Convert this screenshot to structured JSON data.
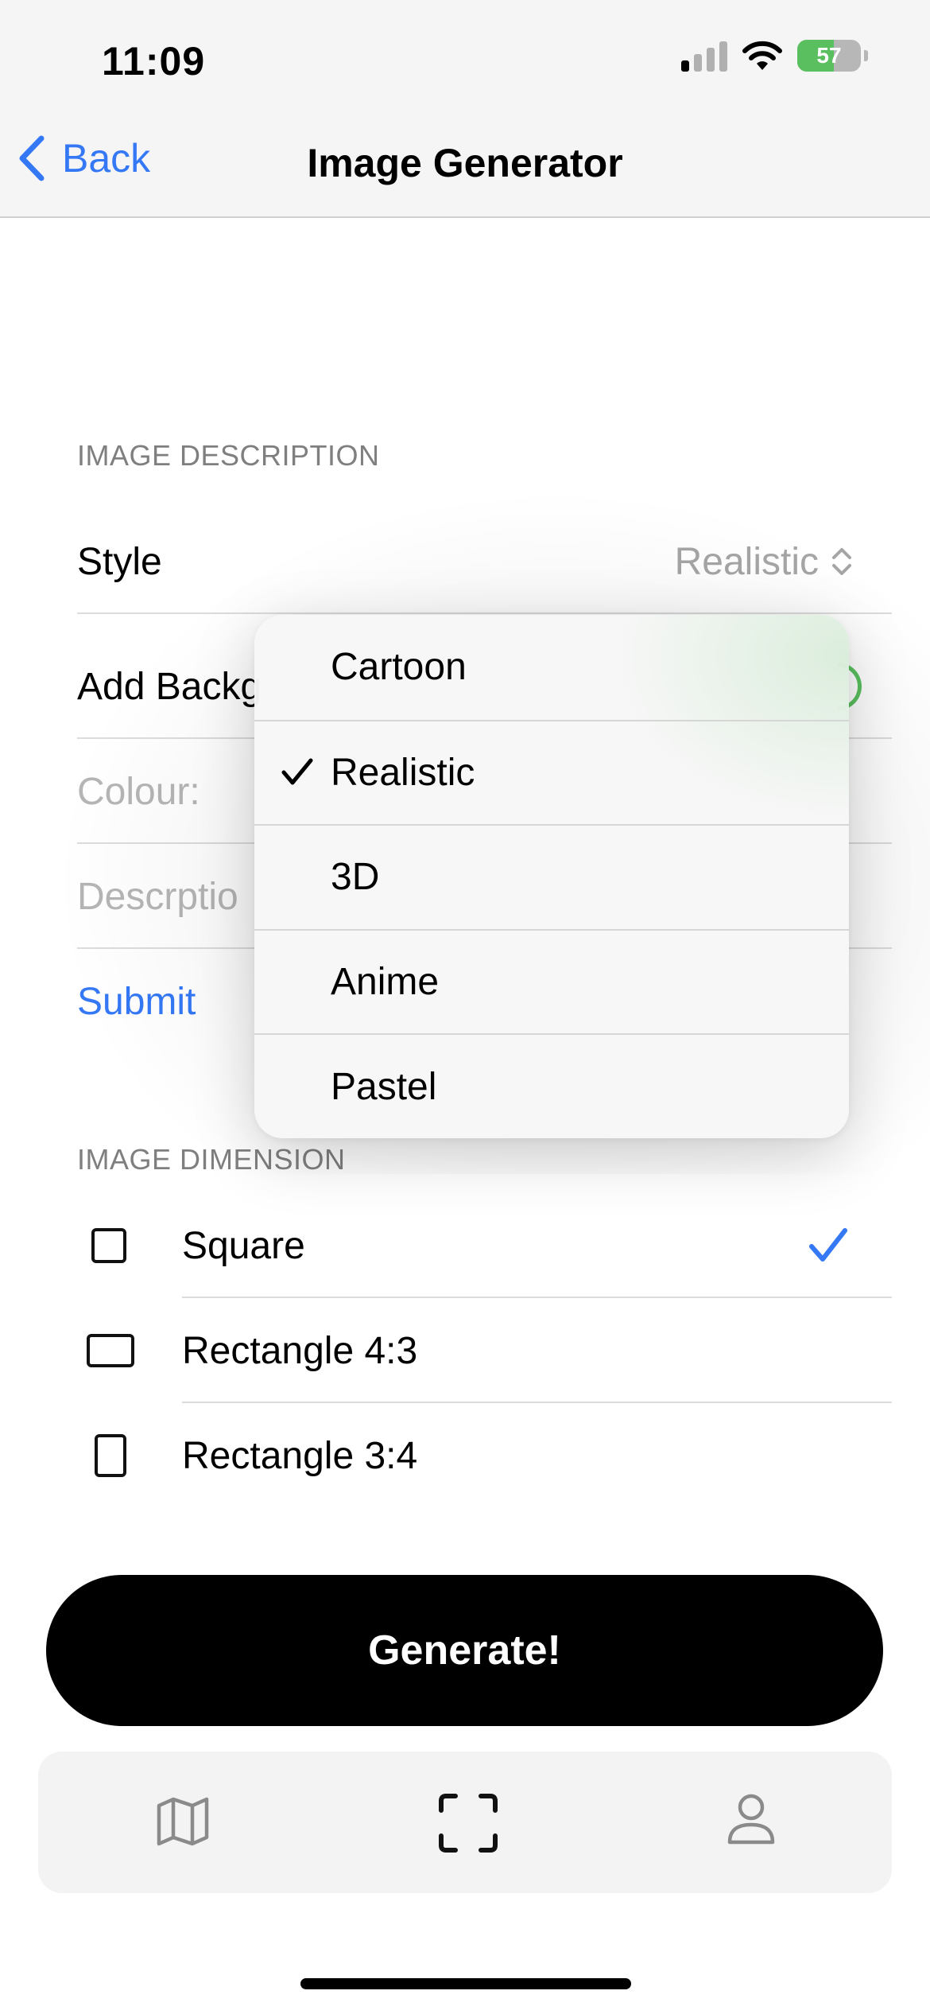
{
  "status_bar": {
    "time": "11:09",
    "battery_percent": "57",
    "battery_level": 0.57,
    "signal_bars_active": 1,
    "signal_bars_total": 4
  },
  "nav": {
    "back_label": "Back",
    "title": "Image Generator"
  },
  "description_section": {
    "header": "IMAGE DESCRIPTION",
    "style_label": "Style",
    "style_value": "Realistic",
    "add_background_label": "Add Backg",
    "colour_placeholder": "Colour:",
    "description_placeholder": "Descrptio",
    "submit_label": "Submit"
  },
  "style_menu": {
    "options": [
      "Cartoon",
      "Realistic",
      "3D",
      "Anime",
      "Pastel"
    ],
    "selected": "Realistic"
  },
  "dimension_section": {
    "header": "IMAGE DIMENSION",
    "options": [
      {
        "label": "Square",
        "selected": true,
        "icon": "square-shape-icon"
      },
      {
        "label": "Rectangle 4:3",
        "selected": false,
        "icon": "landscape-rectangle-icon"
      },
      {
        "label": "Rectangle 3:4",
        "selected": false,
        "icon": "portrait-rectangle-icon"
      }
    ]
  },
  "generate_label": "Generate!",
  "tabbar": {
    "tabs": [
      "map-icon",
      "scan-frame-icon",
      "person-icon"
    ]
  },
  "colors": {
    "accent": "#3478f6",
    "toggle_green": "#5ac05f",
    "button_black": "#000000"
  }
}
